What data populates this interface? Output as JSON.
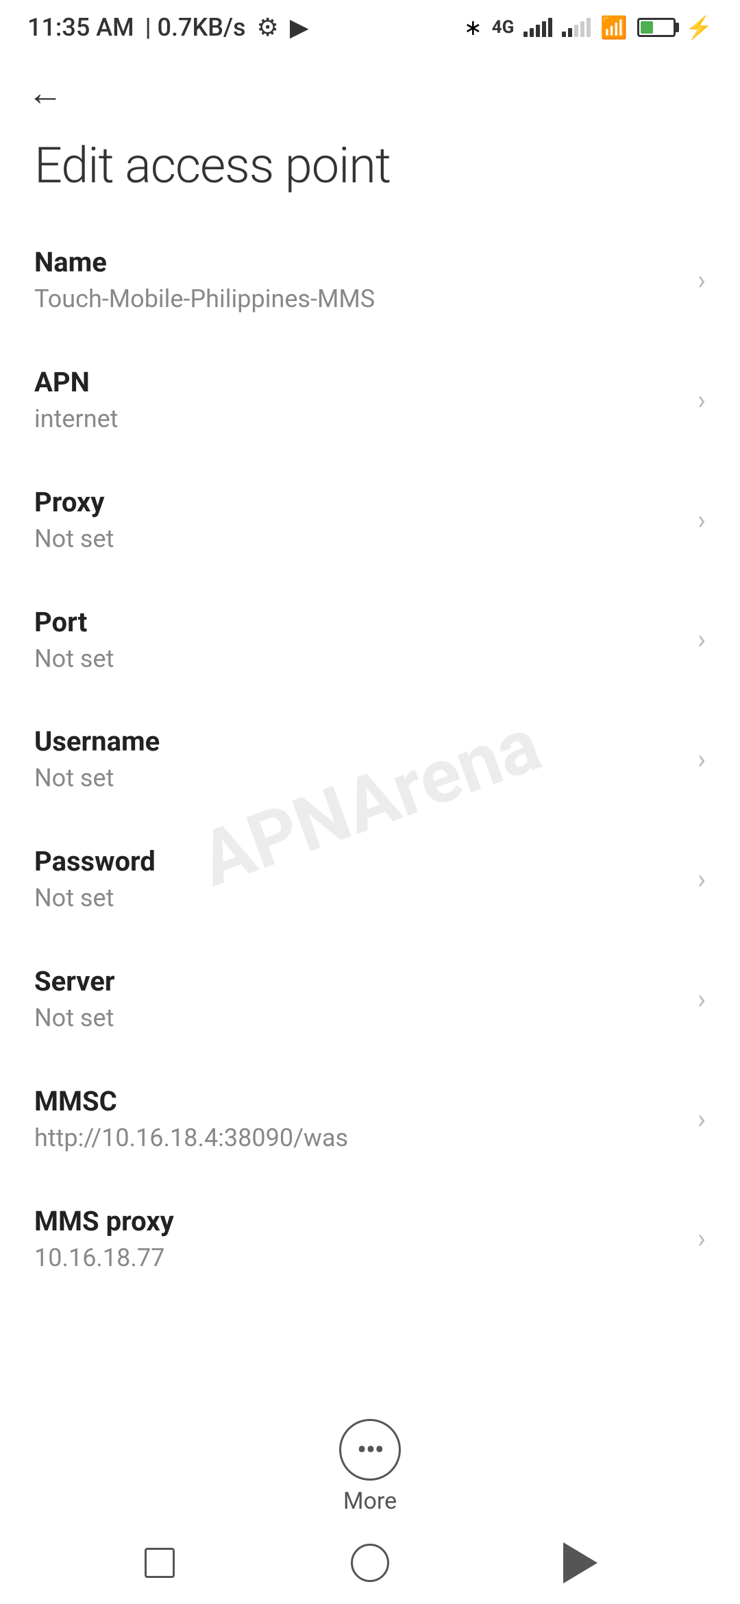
{
  "statusBar": {
    "time": "11:35 AM",
    "speed": "0.7KB/s"
  },
  "header": {
    "backLabel": "←",
    "title": "Edit access point"
  },
  "settings": {
    "items": [
      {
        "label": "Name",
        "value": "Touch-Mobile-Philippines-MMS"
      },
      {
        "label": "APN",
        "value": "internet"
      },
      {
        "label": "Proxy",
        "value": "Not set"
      },
      {
        "label": "Port",
        "value": "Not set"
      },
      {
        "label": "Username",
        "value": "Not set"
      },
      {
        "label": "Password",
        "value": "Not set"
      },
      {
        "label": "Server",
        "value": "Not set"
      },
      {
        "label": "MMSC",
        "value": "http://10.16.18.4:38090/was"
      },
      {
        "label": "MMS proxy",
        "value": "10.16.18.77"
      }
    ]
  },
  "more": {
    "label": "More",
    "icon": "···"
  },
  "watermark": "APNArena"
}
